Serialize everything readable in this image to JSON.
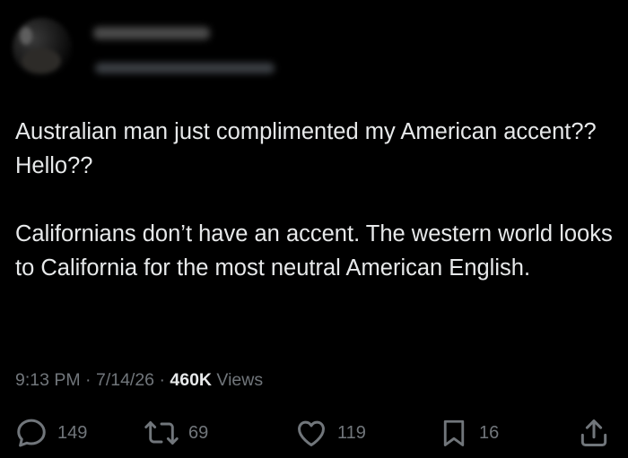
{
  "tweet": {
    "paragraphs": [
      "Australian man just complimented my American accent?? Hello??",
      "Californians don’t have an accent. The western world looks to California for the most neutral American English."
    ],
    "time": "9:13 PM",
    "separator": " · ",
    "date": "7/14/26",
    "views_count": "460K",
    "views_label": " Views"
  },
  "actions": {
    "replies": "149",
    "retweets": "69",
    "likes": "119",
    "bookmarks": "16"
  },
  "icons": {
    "reply": "reply-icon",
    "retweet": "retweet-icon",
    "like": "heart-icon",
    "bookmark": "bookmark-icon",
    "share": "share-icon"
  },
  "colors": {
    "background": "#000000",
    "text": "#e7e9ea",
    "secondary": "#71767b"
  }
}
